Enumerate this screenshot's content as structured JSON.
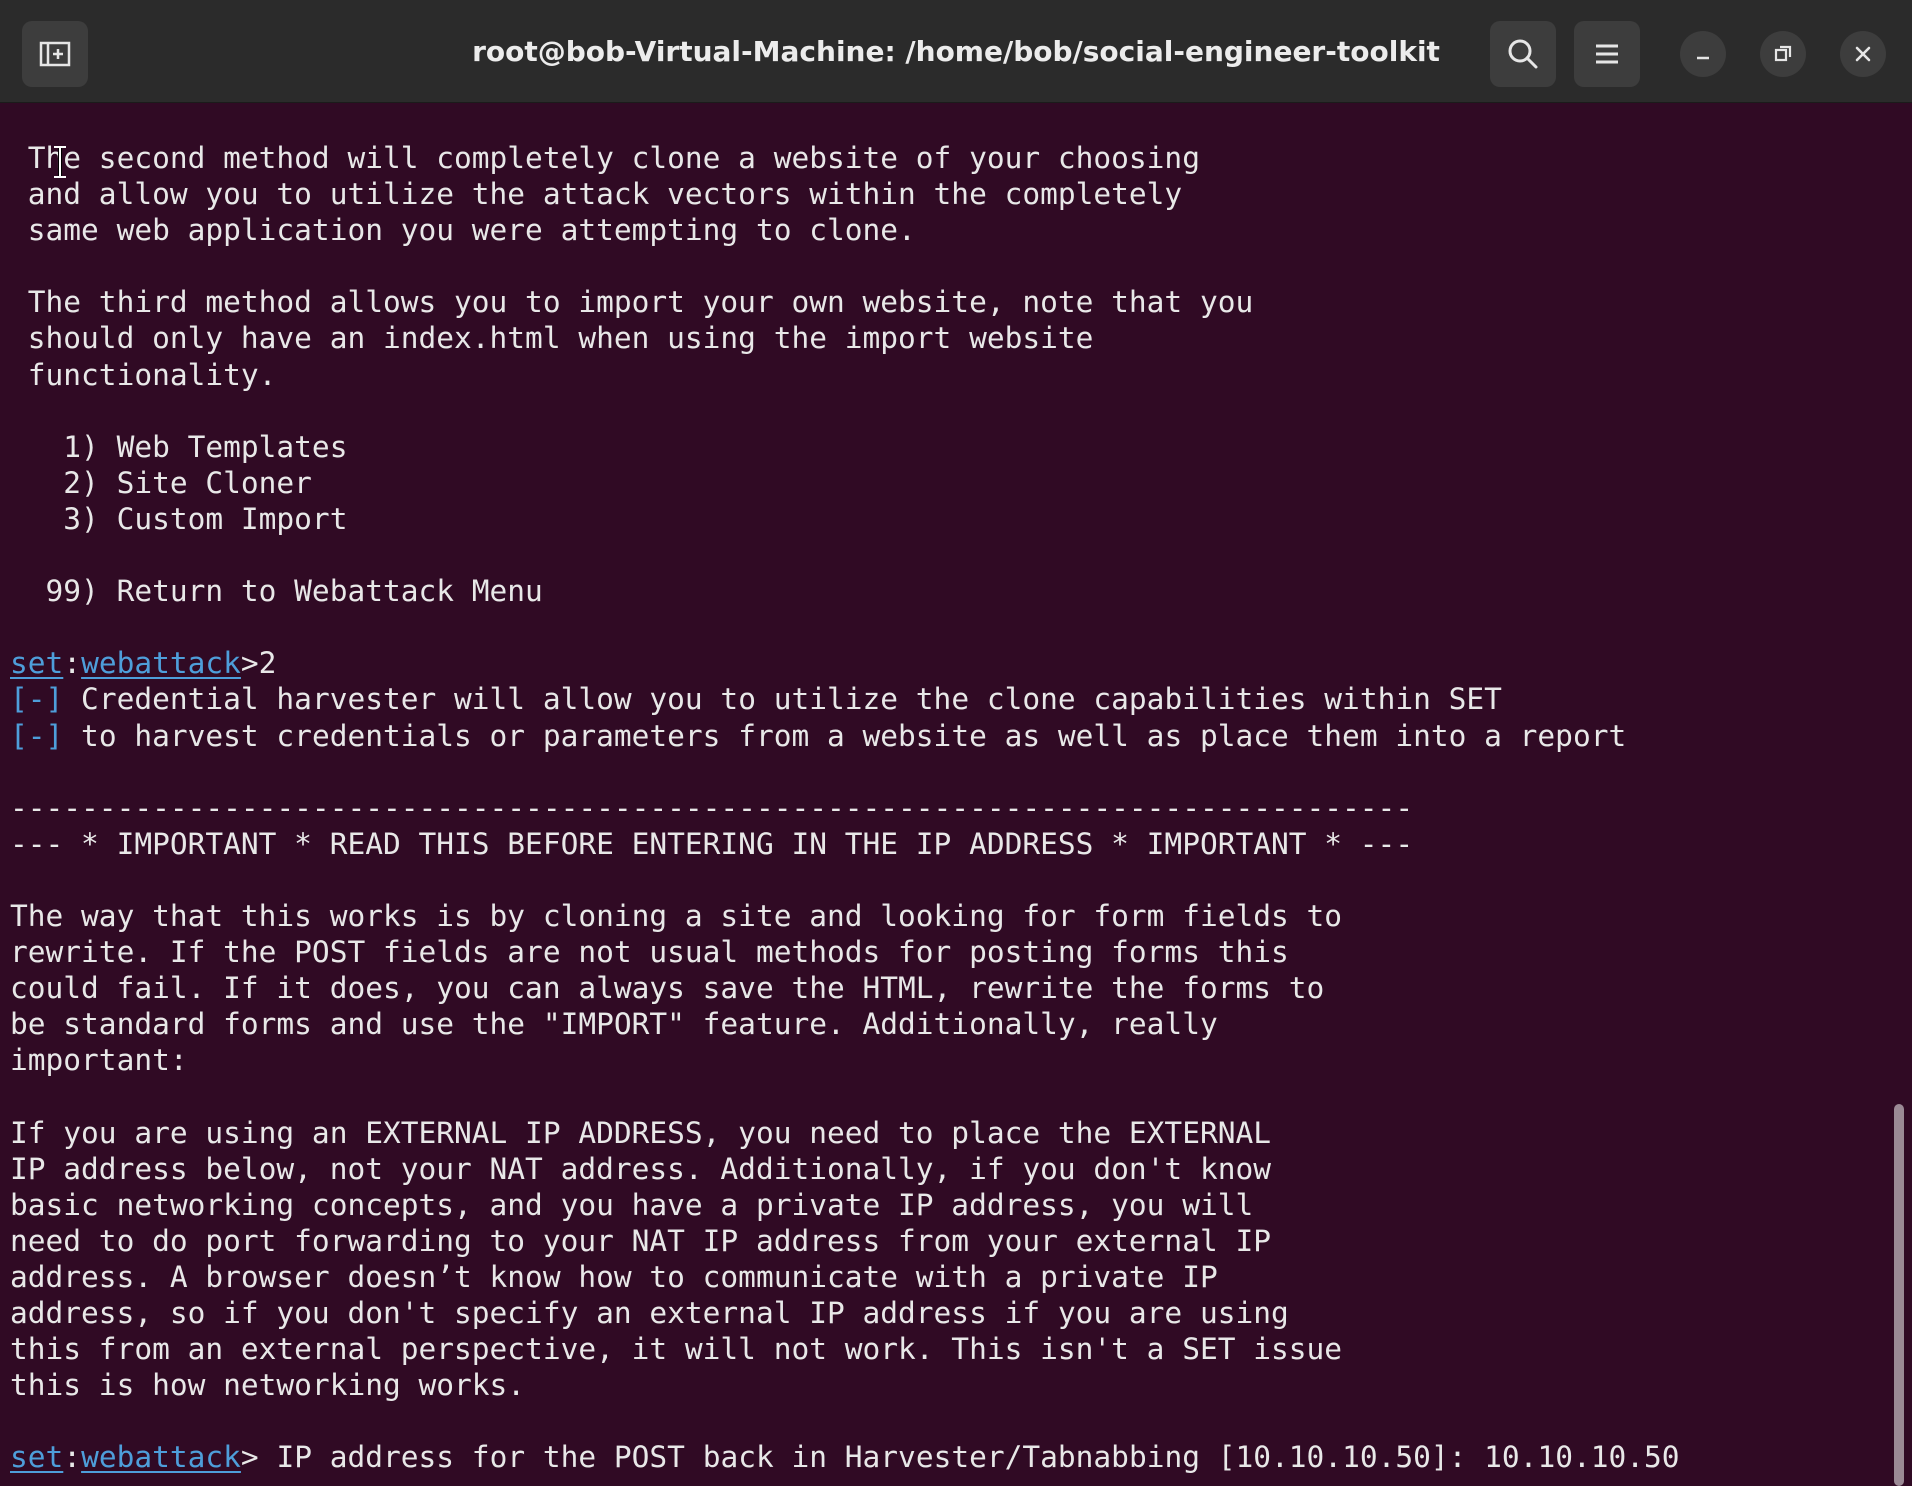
{
  "window": {
    "title": "root@bob-Virtual-Machine: /home/bob/social-engineer-toolkit",
    "buttons": [
      "new-tab-icon",
      "search-icon",
      "menu-icon",
      "minimize-icon",
      "restore-icon",
      "close-icon"
    ]
  },
  "colors": {
    "terminal_bg": "#300a24",
    "titlebar_bg": "#2b2b2b",
    "text": "#e8e8e8",
    "prompt_blue": "#4e9eda"
  },
  "terminal": {
    "l1": " The second method will completely clone a website of your choosing",
    "l2": " and allow you to utilize the attack vectors within the completely",
    "l3": " same web application you were attempting to clone.",
    "l4": " The third method allows you to import your own website, note that you",
    "l5": " should only have an index.html when using the import website",
    "l6": " functionality.",
    "menu1": "   1) Web Templates",
    "menu2": "   2) Site Cloner",
    "menu3": "   3) Custom Import",
    "menu99": "  99) Return to Webattack Menu",
    "prompt_set": "set",
    "prompt_colon": ":",
    "prompt_webattack": "webattack",
    "prompt_input1": ">2",
    "info_bracket": "[-]",
    "info1": " Credential harvester will allow you to utilize the clone capabilities within SET",
    "info2": " to harvest credentials or parameters from a website as well as place them into a report",
    "dashes": "-------------------------------------------------------------------------------",
    "important": "--- * IMPORTANT * READ THIS BEFORE ENTERING IN THE IP ADDRESS * IMPORTANT * ---",
    "p1": "The way that this works is by cloning a site and looking for form fields to",
    "p2": "rewrite. If the POST fields are not usual methods for posting forms this",
    "p3": "could fail. If it does, you can always save the HTML, rewrite the forms to",
    "p4": "be standard forms and use the \"IMPORT\" feature. Additionally, really",
    "p5": "important:",
    "q1": "If you are using an EXTERNAL IP ADDRESS, you need to place the EXTERNAL",
    "q2": "IP address below, not your NAT address. Additionally, if you don't know",
    "q3": "basic networking concepts, and you have a private IP address, you will",
    "q4": "need to do port forwarding to your NAT IP address from your external IP",
    "q5": "address. A browser doesn’t know how to communicate with a private IP",
    "q6": "address, so if you don't specify an external IP address if you are using",
    "q7": "this from an external perspective, it will not work. This isn't a SET issue",
    "q8": "this is how networking works.",
    "prompt_input2": "> IP address for the POST back in Harvester/Tabnabbing [10.10.10.50]: 10.10.10.50"
  }
}
